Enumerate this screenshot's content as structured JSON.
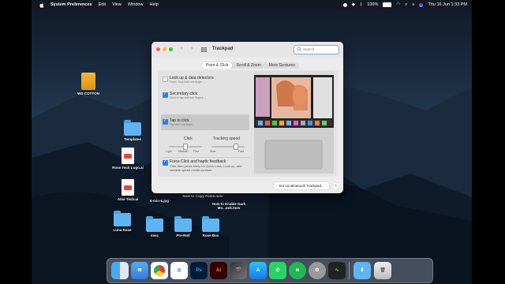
{
  "menubar": {
    "app": "System Preferences",
    "items": [
      "Edit",
      "View",
      "Window",
      "Help"
    ],
    "battery": "100%",
    "clock": "Thu 16 Jun  1:33 PM"
  },
  "desktop": {
    "icons": [
      {
        "label": "WD COTTON"
      },
      {
        "label": "Templates"
      },
      {
        "label": "Rose Tech Logo.ai"
      },
      {
        "label": "Aloe Tech.ai"
      },
      {
        "label": "6-min-6.jpg"
      },
      {
        "label": "How to Copy Paste.mov"
      },
      {
        "label": "How to Enable Dark Mo...ook.mov"
      },
      {
        "label": "Luna Rose"
      },
      {
        "label": "misc"
      },
      {
        "label": "Pre-Roll"
      },
      {
        "label": "Rose Box"
      }
    ]
  },
  "window": {
    "title": "Trackpad",
    "search_placeholder": "Search",
    "tabs": [
      "Point & Click",
      "Scroll & Zoom",
      "More Gestures"
    ],
    "active_tab": 0,
    "options": [
      {
        "title": "Look up & data detectors",
        "sub": "Force Click with one finger ⌄",
        "checked": false
      },
      {
        "title": "Secondary click",
        "sub": "Click or tap with two fingers ⌄",
        "checked": true
      },
      {
        "title": "Tap to click",
        "sub": "Tap with one finger",
        "checked": true
      },
      {
        "title": "Force Click and haptic feedback",
        "sub": "Click then press firmly for Quick Look, Look up, and variable speed media controls.",
        "checked": true
      }
    ],
    "click": {
      "label": "Click",
      "ticks": [
        "Light",
        "Medium",
        "Firm"
      ],
      "value": "Medium"
    },
    "tracking": {
      "label": "Tracking speed",
      "ticks": [
        "Slow",
        "Fast"
      ],
      "value": 0.78
    },
    "bluetooth_button": "Set Up Bluetooth Trackpad...",
    "help_button": "?"
  },
  "dock": {
    "apps": [
      "finder-icon",
      "mail-icon",
      "chrome-icon",
      "safari-icon",
      "photoshop-icon",
      "illustrator-icon",
      "final-cut-icon",
      "app-store-icon",
      "whatsapp-icon",
      "spotify-icon",
      "system-preferences-icon",
      "activity-monitor-icon",
      "downloads-folder-icon",
      "trash-icon"
    ],
    "labels": {
      "ps": "Ps",
      "ai": "Ai"
    }
  }
}
